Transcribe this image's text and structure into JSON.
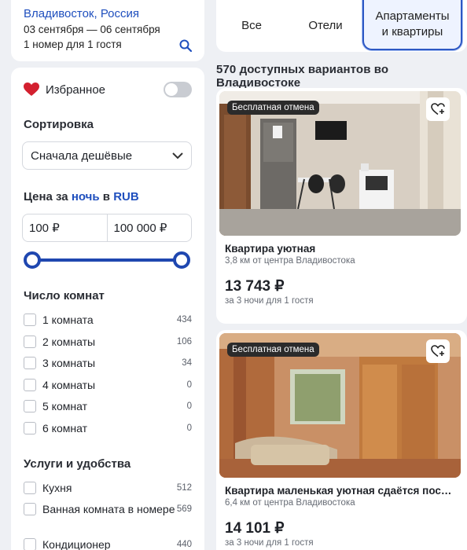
{
  "search": {
    "city": "Владивосток, Россия",
    "dates": "03 сентября — 06 сентября",
    "guests": "1 номер для 1 гостя"
  },
  "tabs": [
    {
      "label": "Все"
    },
    {
      "label": "Отели"
    },
    {
      "label": "Апартаменты\nи квартиры",
      "active": true
    }
  ],
  "results": {
    "count_text": "570 доступных вариантов во Владивостоке"
  },
  "filters": {
    "favorites_label": "Избранное",
    "favorites_on": false,
    "sort_title": "Сортировка",
    "sort_value": "Сначала дешёвые",
    "price_title_prefix": "Цена за",
    "price_title_unit": "ночь",
    "price_title_mid": "в",
    "price_title_currency": "RUB",
    "price_min": "100 ₽",
    "price_max": "100 000 ₽",
    "slider_min_fraction": 0,
    "slider_max_fraction": 1,
    "rooms_title": "Число комнат",
    "rooms": [
      {
        "label": "1 комната",
        "count": "434"
      },
      {
        "label": "2 комнаты",
        "count": "106"
      },
      {
        "label": "3 комнаты",
        "count": "34"
      },
      {
        "label": "4 комнаты",
        "count": "0"
      },
      {
        "label": "5 комнат",
        "count": "0"
      },
      {
        "label": "6 комнат",
        "count": "0"
      }
    ],
    "amenities_title": "Услуги и удобства",
    "amenities": [
      {
        "label": "Кухня",
        "count": "512"
      },
      {
        "label": "Ванная комната в номере",
        "count": "569"
      },
      {
        "label": "Кондиционер",
        "count": "440"
      }
    ]
  },
  "listings": [
    {
      "badge": "Бесплатная отмена",
      "title": "Квартира уютная",
      "distance": "3,8 км от центра Владивостока",
      "price": "13 743 ₽",
      "nights": "за 3 ночи для 1 гостя"
    },
    {
      "badge": "Бесплатная отмена",
      "title": "Квартира маленькая уютная сдаётся посу...",
      "distance": "6,4 км от центра Владивостока",
      "price": "14 101 ₽",
      "nights": "за 3 ночи для 1 гостя"
    }
  ],
  "colors": {
    "accent": "#1f4fbe",
    "slider": "#1f47b0",
    "heart": "#d3202f"
  },
  "icons": [
    "search-icon",
    "heart-icon",
    "chevron-down-icon",
    "heart-plus-icon"
  ]
}
